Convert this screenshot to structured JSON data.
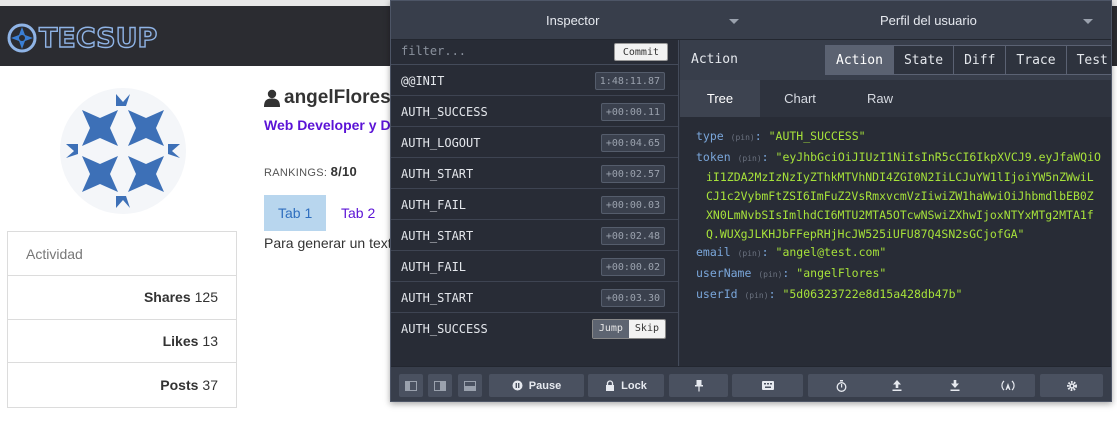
{
  "site": {
    "logo_text": "TECSUP",
    "colors": {
      "topbar": "#2b2c31",
      "accent": "#5b13d6",
      "tab_active_bg": "#b8d6ee"
    }
  },
  "profile": {
    "username": "angelFlores",
    "role": "Web Developer y Dis",
    "rankings_label": "RANKINGS:",
    "rankings_value": "8/10",
    "tabs": [
      "Tab 1",
      "Tab 2"
    ],
    "tab_content": "Para generar un text",
    "activity": {
      "title": "Actividad",
      "stats": [
        {
          "label": "Shares",
          "value": "125"
        },
        {
          "label": "Likes",
          "value": "13"
        },
        {
          "label": "Posts",
          "value": "37"
        }
      ]
    }
  },
  "devtools": {
    "instance_select": "Inspector",
    "store_select": "Perfil del usuario",
    "filter_placeholder": "filter...",
    "commit_label": "Commit",
    "jump_label": "Jump",
    "skip_label": "Skip",
    "actions": [
      {
        "name": "@@INIT",
        "time": "1:48:11.87"
      },
      {
        "name": "AUTH_SUCCESS",
        "time": "+00:00.11"
      },
      {
        "name": "AUTH_LOGOUT",
        "time": "+00:04.65"
      },
      {
        "name": "AUTH_START",
        "time": "+00:02.57"
      },
      {
        "name": "AUTH_FAIL",
        "time": "+00:00.03"
      },
      {
        "name": "AUTH_START",
        "time": "+00:02.48"
      },
      {
        "name": "AUTH_FAIL",
        "time": "+00:00.02"
      },
      {
        "name": "AUTH_START",
        "time": "+00:03.30"
      },
      {
        "name": "AUTH_SUCCESS",
        "time": ""
      }
    ],
    "monitor_title": "Action",
    "monitor_tabs": [
      "Action",
      "State",
      "Diff",
      "Trace",
      "Test"
    ],
    "sub_tabs": [
      "Tree",
      "Chart",
      "Raw"
    ],
    "pin_label": "(pin)",
    "tree": {
      "type_key": "type",
      "type_value": "\"AUTH_SUCCESS\"",
      "token_key": "token",
      "token_first": "\"eyJhbGciOiJIUzI1NiIsInR5cCI6IkpXVCJ9.eyJfaWQiO",
      "token_rest": "iI1ZDA2MzIzNzIyZThkMTVhNDI4ZGI0N2IiLCJuYW1lIjoiYW5nZWwiLCJ1c2VybmFtZSI6ImFuZ2VsRmxvcmVzIiwiZW1haWwiOiJhbmdlbEB0ZXN0LmNvbSIsImlhdCI6MTU2MTA5OTcwNSwiZXhwIjoxNTYxMTg2MTA1fQ.WUXgJLKHJbFFepRHjHcJW525iUFU87Q4SN2sGCjofGA\"",
      "email_key": "email",
      "email_value": "\"angel@test.com\"",
      "username_key": "userName",
      "username_value": "\"angelFlores\"",
      "userid_key": "userId",
      "userid_value": "\"5d06323722e8d15a428db47b\""
    },
    "toolbar": {
      "pause_label": "Pause",
      "lock_label": "Lock"
    },
    "colors": {
      "panel_bg": "#2a2f3a",
      "key": "#7aa6da",
      "value": "#a7e23a"
    }
  }
}
